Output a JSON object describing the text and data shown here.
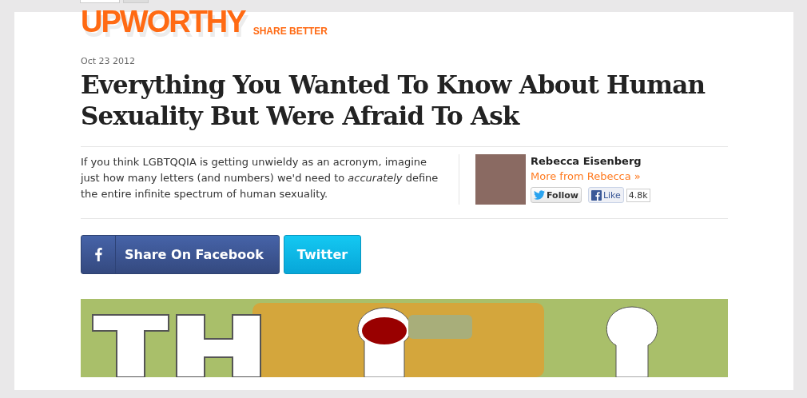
{
  "header": {
    "logo": "UPWORTHY",
    "tagline": "SHARE BETTER"
  },
  "article": {
    "date": "Oct 23 2012",
    "title": "Everything You Wanted To Know About Human Sexuality But Were Afraid To Ask",
    "summary": "If you think LGBTQQIA is getting unwieldy as an acronym, imagine just how many letters (and numbers) we'd need to *accurately* define the entire infinite spectrum of human sexuality."
  },
  "author": {
    "name": "Rebecca Eisenberg",
    "more_link": "More from Rebecca »",
    "follow_button": "Follow",
    "like_button": "Like",
    "like_count": "4.8k"
  },
  "share_buttons": [
    {
      "kind": "facebook",
      "label": "Share On Facebook"
    },
    {
      "kind": "twitter",
      "label": "Twitter"
    }
  ]
}
